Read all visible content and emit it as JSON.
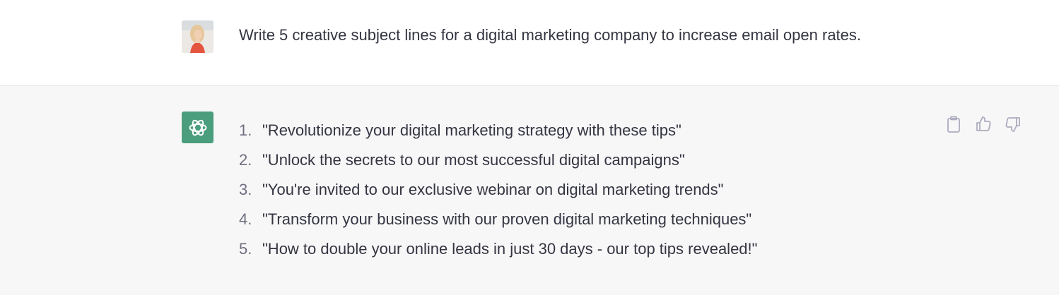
{
  "conversation": {
    "user": {
      "message": "Write 5 creative subject lines for a digital marketing company to increase email open rates.",
      "avatar_icon": "user-avatar-photo"
    },
    "assistant": {
      "avatar_icon": "openai-logo-icon",
      "avatar_color": "#4a9d7d",
      "items": [
        {
          "number": "1.",
          "text": "\"Revolutionize your digital marketing strategy with these tips\""
        },
        {
          "number": "2.",
          "text": "\"Unlock the secrets to our most successful digital campaigns\""
        },
        {
          "number": "3.",
          "text": "\"You're invited to our exclusive webinar on digital marketing trends\""
        },
        {
          "number": "4.",
          "text": "\"Transform your business with our proven digital marketing techniques\""
        },
        {
          "number": "5.",
          "text": "\"How to double your online leads in just 30 days - our top tips revealed!\""
        }
      ],
      "actions": [
        "clipboard-icon",
        "thumbs-up-icon",
        "thumbs-down-icon"
      ]
    }
  }
}
